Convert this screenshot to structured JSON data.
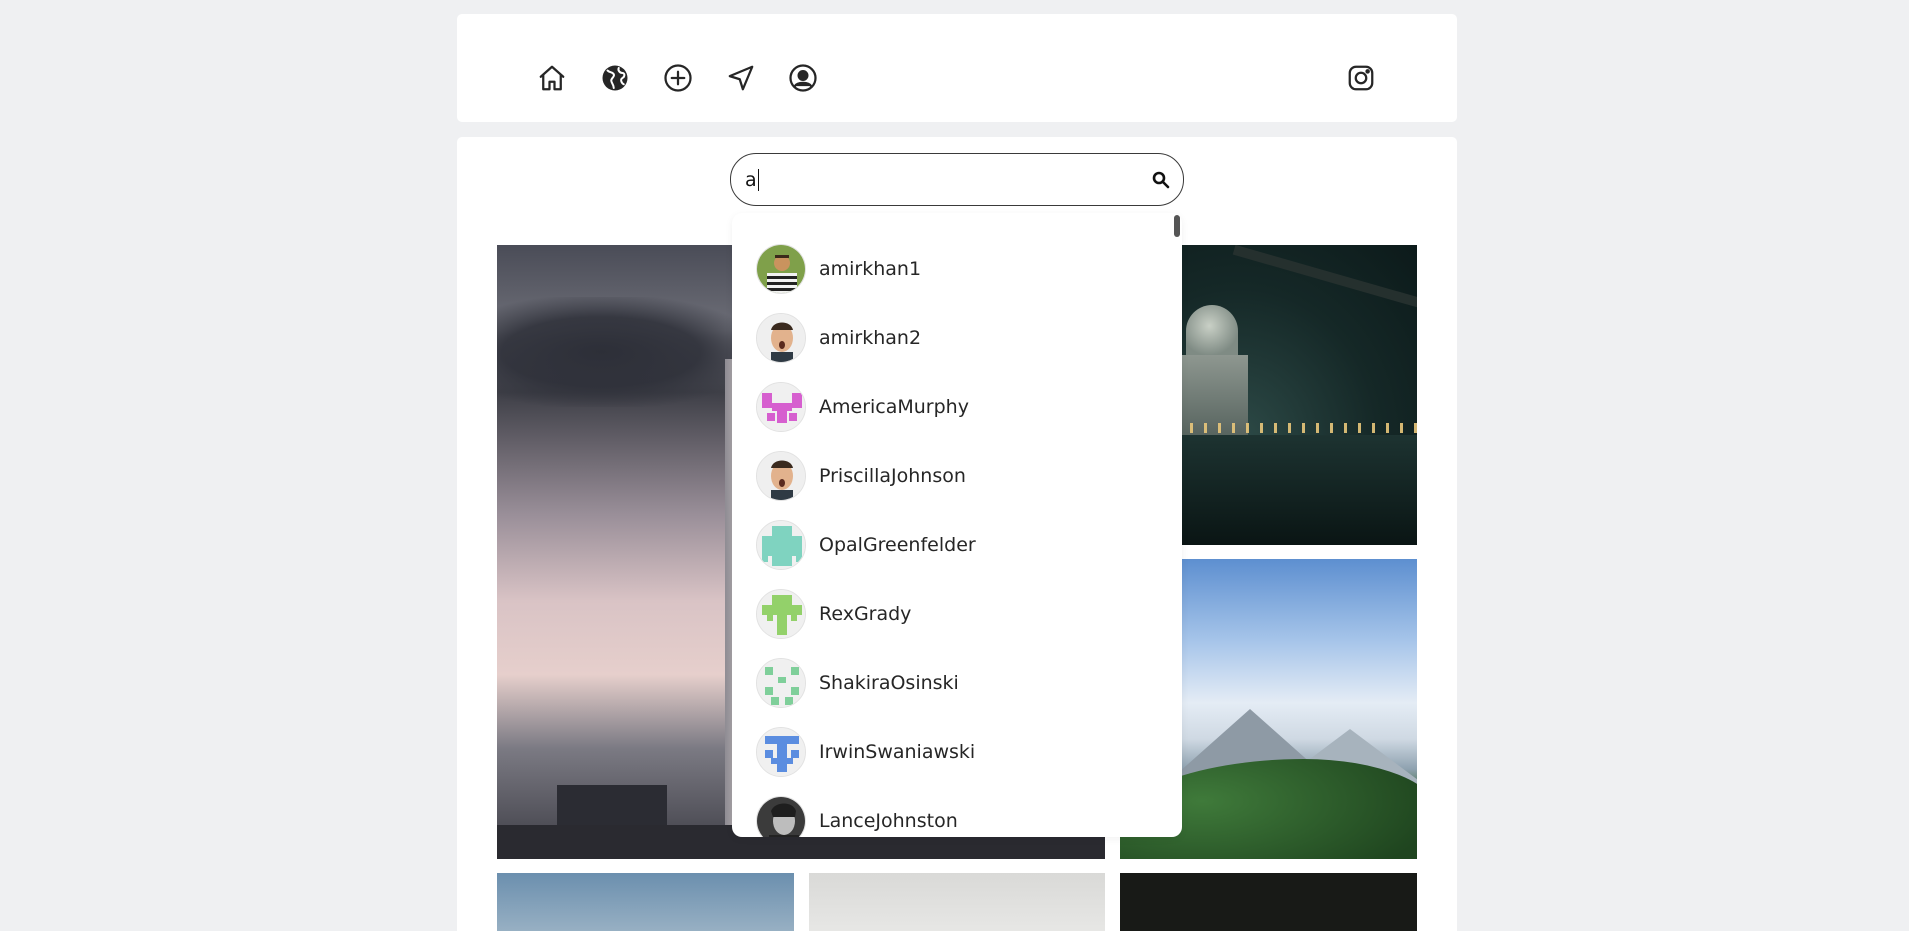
{
  "nav": {
    "icons": [
      "home-icon",
      "globe-icon",
      "add-post-icon",
      "direct-send-icon",
      "profile-icon"
    ],
    "brand_icon": "instagram-icon"
  },
  "search": {
    "value": "a",
    "icon": "search-icon"
  },
  "results": [
    {
      "username": "amirkhan1",
      "avatar": "photo-striped-shirt"
    },
    {
      "username": "amirkhan2",
      "avatar": "photo-surprised-face"
    },
    {
      "username": "AmericaMurphy",
      "avatar": "identicon",
      "color": "#d65fcf"
    },
    {
      "username": "PriscillaJohnson",
      "avatar": "photo-surprised-face"
    },
    {
      "username": "OpalGreenfelder",
      "avatar": "identicon",
      "color": "#7fd3c0"
    },
    {
      "username": "RexGrady",
      "avatar": "identicon",
      "color": "#93d16a"
    },
    {
      "username": "ShakiraOsinski",
      "avatar": "identicon",
      "color": "#7fcf9a"
    },
    {
      "username": "IrwinSwaniawski",
      "avatar": "identicon",
      "color": "#5b8de0"
    },
    {
      "username": "LanceJohnston",
      "avatar": "photo-portrait-bw"
    }
  ]
}
